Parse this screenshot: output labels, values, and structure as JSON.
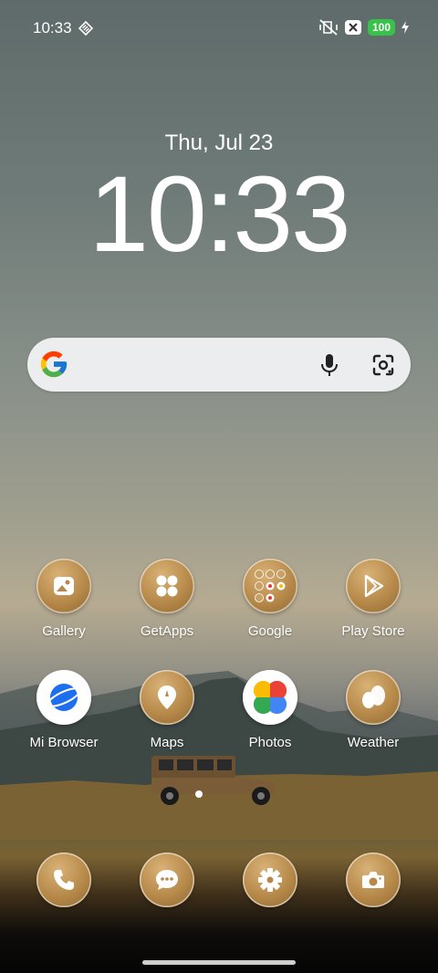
{
  "status_bar": {
    "time": "10:33",
    "battery": "100"
  },
  "lockscreen": {
    "date": "Thu, Jul 23",
    "clock": "10:33"
  },
  "search": {
    "logo": "google-logo",
    "icons": [
      "mic-icon",
      "lens-icon"
    ]
  },
  "apps_row1": [
    {
      "label": "Gallery",
      "icon": "gallery-icon"
    },
    {
      "label": "GetApps",
      "icon": "getapps-icon"
    },
    {
      "label": "Google",
      "icon": "google-folder-icon"
    },
    {
      "label": "Play Store",
      "icon": "play-store-icon"
    }
  ],
  "apps_row2": [
    {
      "label": "Mi Browser",
      "icon": "mi-browser-icon"
    },
    {
      "label": "Maps",
      "icon": "maps-icon"
    },
    {
      "label": "Photos",
      "icon": "photos-icon"
    },
    {
      "label": "Weather",
      "icon": "weather-icon"
    }
  ],
  "dock": [
    {
      "icon": "phone-icon"
    },
    {
      "icon": "messages-icon"
    },
    {
      "icon": "settings-icon"
    },
    {
      "icon": "camera-icon"
    }
  ],
  "colors": {
    "icon_gold": "#b68949",
    "battery_green": "#37c24a"
  }
}
